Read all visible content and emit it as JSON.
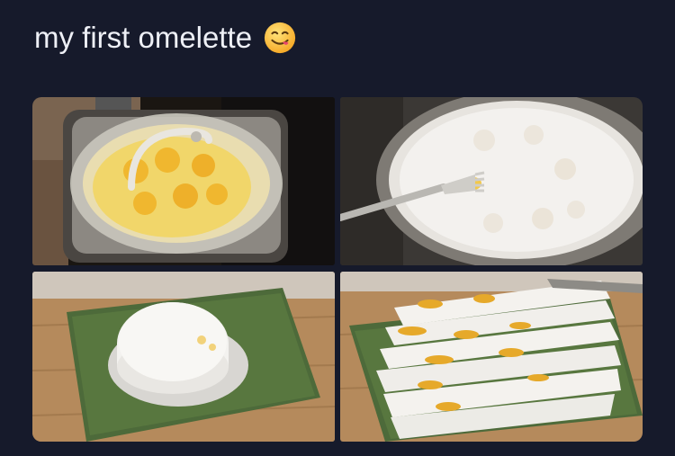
{
  "post": {
    "title": "my first omelette",
    "emoji_icon": "yum-face-emoji-icon"
  },
  "photos": [
    {
      "subject": "pan-with-eggs-under-glass-lid"
    },
    {
      "subject": "eggs-boiling-in-milk-with-fork"
    },
    {
      "subject": "white-omelette-round-on-cutting-board"
    },
    {
      "subject": "sliced-omelette-with-yolks"
    }
  ],
  "colors": {
    "background": "#161a2b",
    "title_text": "#eef0f6"
  }
}
